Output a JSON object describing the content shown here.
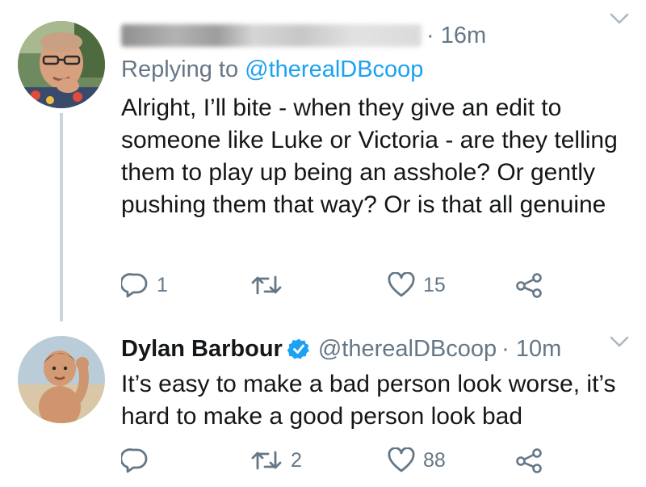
{
  "tweets": [
    {
      "author": {
        "display_name": "",
        "handle": "",
        "name_obscured": true,
        "avatar_icon": "man-with-glasses-avatar"
      },
      "time_label": "· 16m",
      "replying_prefix": "Replying to",
      "replying_mention": "@therealDBcoop",
      "text": "Alright, I’ll bite - when they give an edit to someone like Luke or Victoria - are they telling them to play up being an asshole? Or gently pushing them that way? Or is that all genuine",
      "actions": {
        "reply_count": "1",
        "retweet_count": "",
        "like_count": "15"
      }
    },
    {
      "author": {
        "display_name": "Dylan Barbour",
        "handle": "@therealDBcoop",
        "verified": true,
        "avatar_icon": "child-photo-avatar"
      },
      "time_label": "· 10m",
      "text": "It’s easy to make a bad person look worse, it’s hard to make a good person look bad",
      "actions": {
        "reply_count": "",
        "retweet_count": "2",
        "like_count": "88"
      }
    }
  ],
  "colors": {
    "accent": "#1da1f2",
    "muted": "#657786",
    "text": "#14171a",
    "thread_line": "#cdd5dc"
  }
}
